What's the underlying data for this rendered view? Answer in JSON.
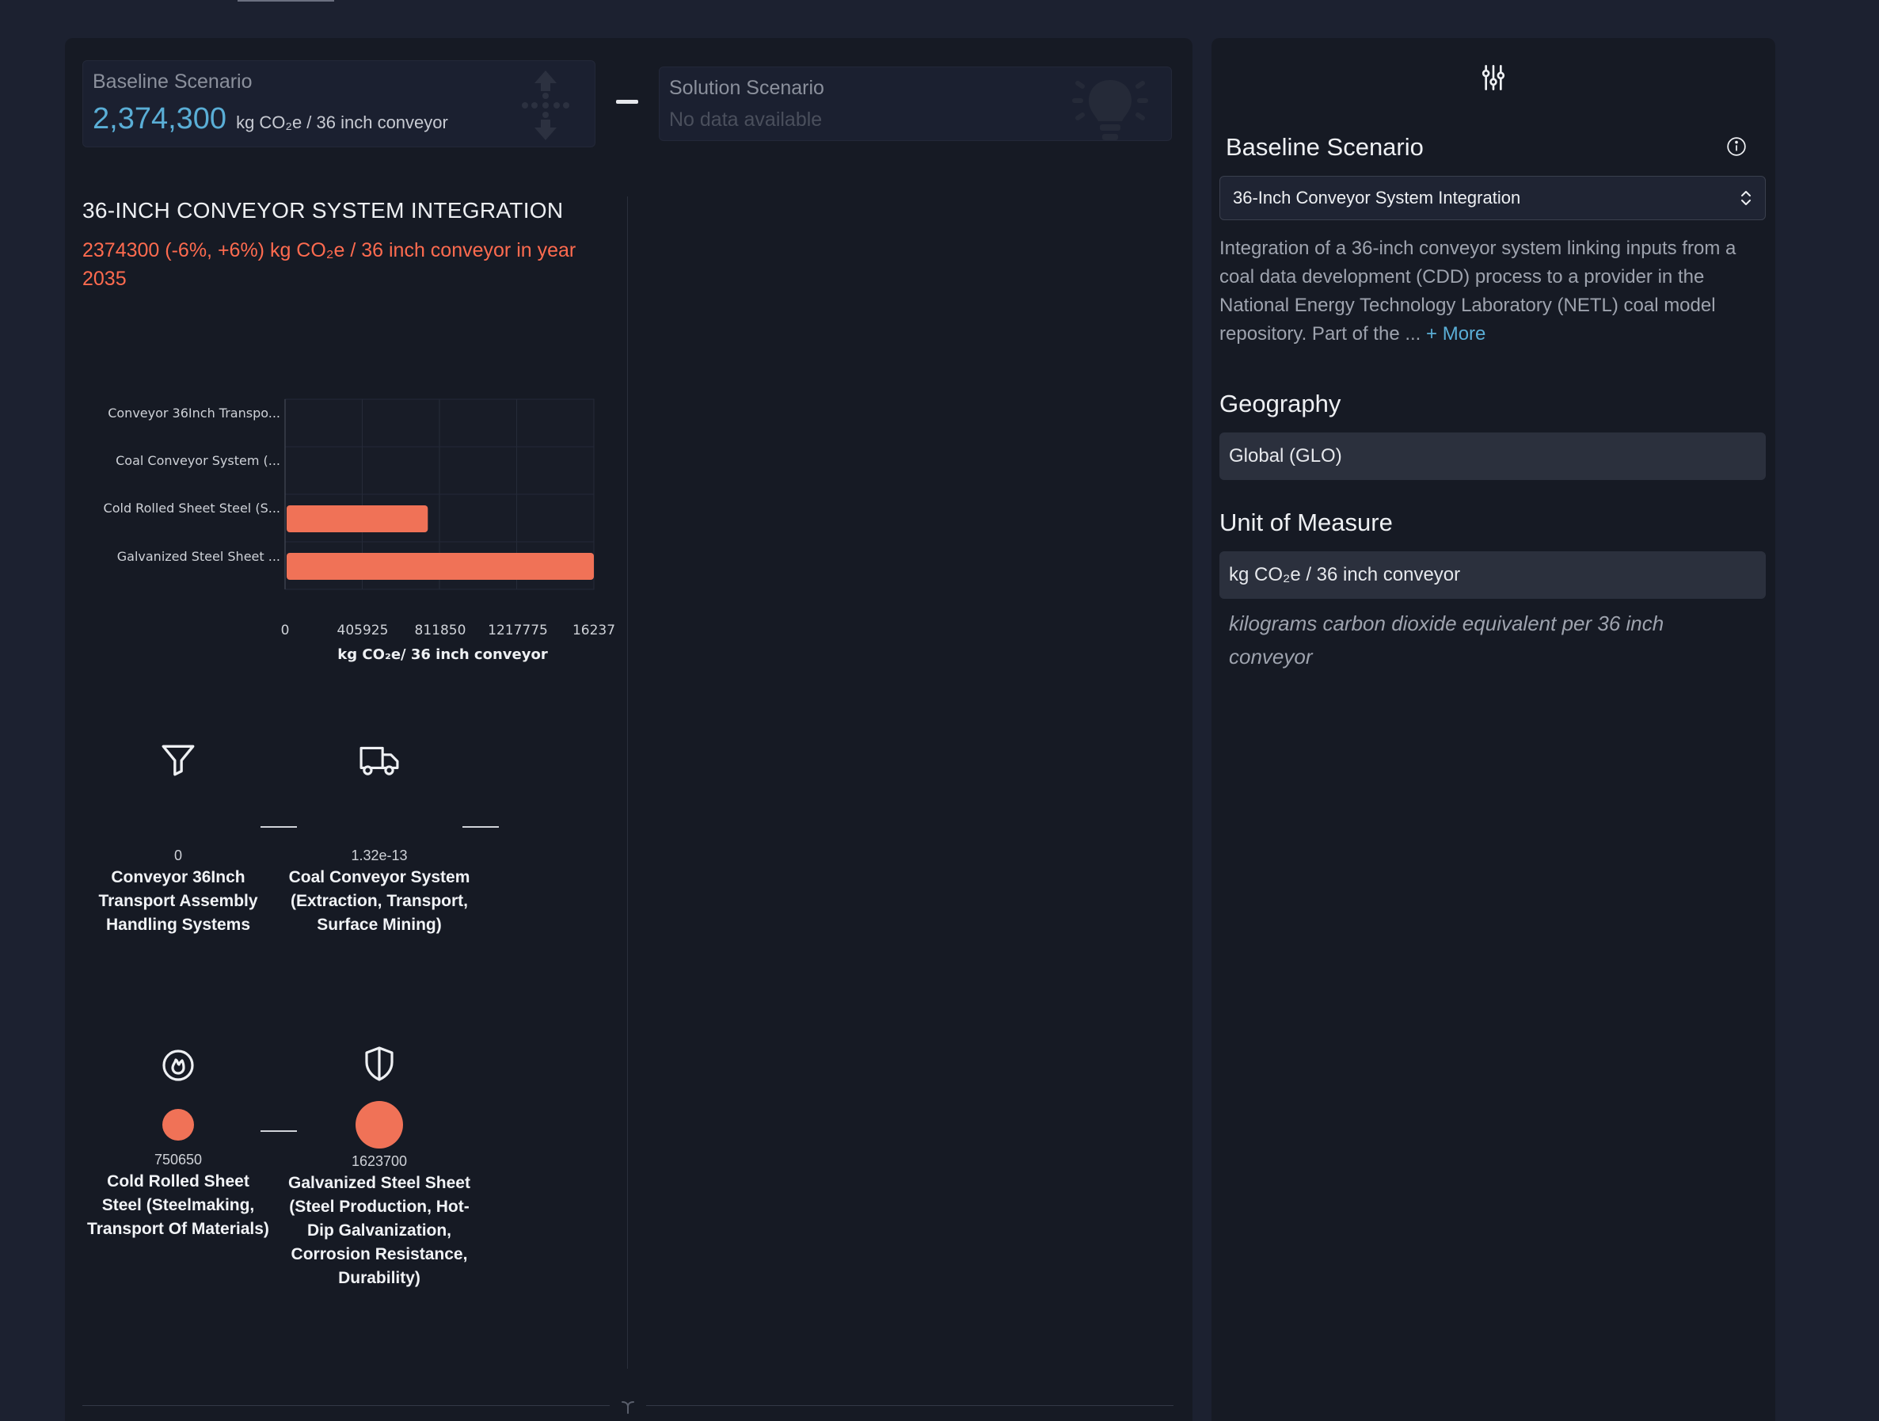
{
  "baseline_card": {
    "title": "Baseline Scenario",
    "value": "2,374,300",
    "unit": "kg CO₂e / 36 inch conveyor"
  },
  "solution_card": {
    "title": "Solution Scenario",
    "status": "No data available"
  },
  "section": {
    "title": "36-INCH CONVEYOR SYSTEM INTEGRATION",
    "subtitle": "2374300 (-6%, +6%) kg CO₂e / 36 inch conveyor in year 2035"
  },
  "chart_data": {
    "type": "bar",
    "orientation": "horizontal",
    "categories": [
      "Conveyor 36Inch Transpo...",
      "Coal Conveyor System (...",
      "Cold Rolled Sheet Steel (S...",
      "Galvanized Steel Sheet ..."
    ],
    "values": [
      0,
      1.32e-13,
      750650,
      1623700
    ],
    "x_ticks": [
      "0",
      "405925",
      "811850",
      "1217775",
      "16237"
    ],
    "xlim": [
      0,
      1623700
    ],
    "xlabel": "kg CO₂e/ 36 inch conveyor",
    "grid": true,
    "bar_color": "#f07257"
  },
  "nodes": [
    {
      "icon": "funnel-icon",
      "value": "0",
      "name": "Conveyor 36Inch Transport Assembly Handling Systems"
    },
    {
      "icon": "truck-icon",
      "value": "1.32e-13",
      "name": "Coal Conveyor System (Extraction, Transport, Surface Mining)"
    },
    {
      "icon": "flame-icon",
      "value": "750650",
      "name": "Cold Rolled Sheet Steel (Steelmaking, Transport Of Materials)"
    },
    {
      "icon": "shield-icon",
      "value": "1623700",
      "name": "Galvanized Steel Sheet (Steel Production, Hot-Dip Galvanization, Corrosion Resistance, Durability)"
    }
  ],
  "side": {
    "baseline_heading": "Baseline Scenario",
    "selected_scenario": "36-Inch Conveyor System Integration",
    "description": "Integration of a 36-inch conveyor system linking inputs from a coal data development (CDD) process to a provider in the National Energy Technology Laboratory (NETL) coal model repository. Part of the ...",
    "more_label": "+ More",
    "geography_heading": "Geography",
    "geography_value": "Global (GLO)",
    "unit_heading": "Unit of Measure",
    "unit_value": "kg CO₂e / 36 inch conveyor",
    "unit_description": "kilograms carbon dioxide equivalent per 36 inch conveyor"
  },
  "colors": {
    "accent_blue": "#5aaed6",
    "accent_orange": "#ff6b4f",
    "bar": "#f07257"
  }
}
